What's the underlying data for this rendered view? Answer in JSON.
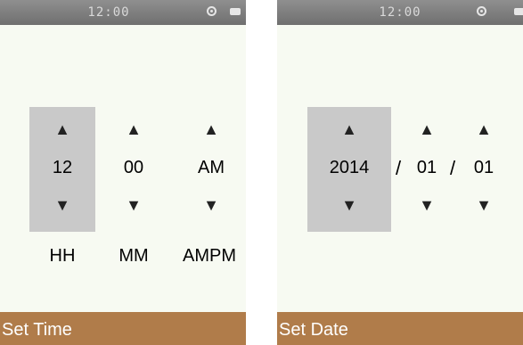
{
  "screens": [
    {
      "status_time": "12:00",
      "columns": [
        {
          "value": "12",
          "label": "HH",
          "selected": true
        },
        {
          "value": "00",
          "label": "MM",
          "selected": false
        },
        {
          "value": "AM",
          "label": "AMPM",
          "selected": false
        }
      ],
      "title": "Set Time"
    },
    {
      "status_time": "12:00",
      "columns": [
        {
          "value": "2014",
          "selected": true
        },
        {
          "value": "01",
          "selected": false
        },
        {
          "value": "01",
          "selected": false
        }
      ],
      "separators": [
        "/",
        "/"
      ],
      "title": "Set Date"
    }
  ],
  "icons": {
    "up": "up-arrow-icon",
    "down": "down-arrow-icon",
    "wifi": "wireless-icon",
    "battery": "battery-icon"
  },
  "colors": {
    "title_bar": "#b07c4a",
    "status_bar": "#7f7f7f",
    "selected_column": "#c9c9c9",
    "background": "#f7faf2"
  }
}
